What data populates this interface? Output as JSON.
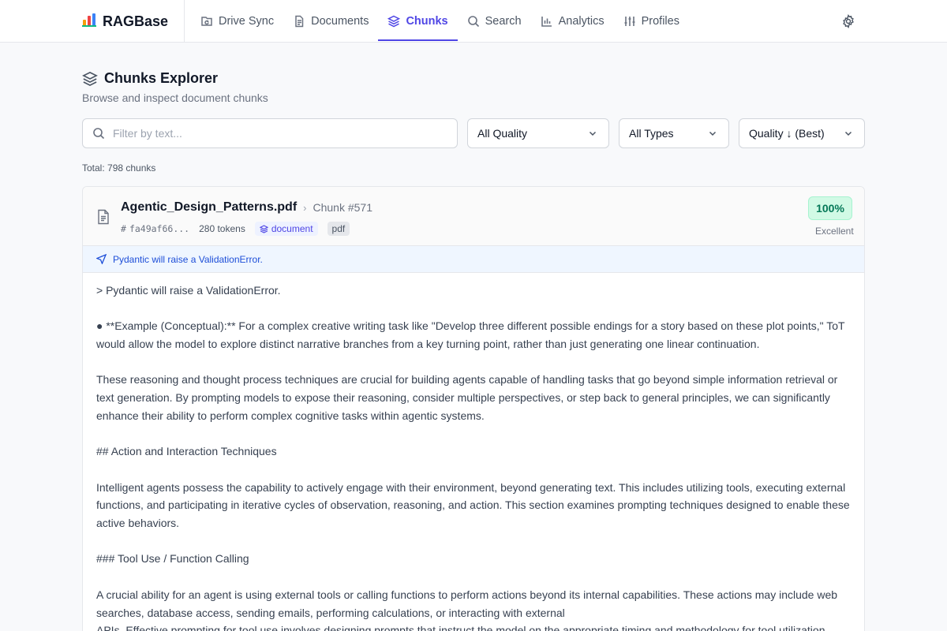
{
  "app": {
    "name": "RAGBase"
  },
  "nav": {
    "items": [
      {
        "label": "Drive Sync",
        "icon": "drive-sync-icon"
      },
      {
        "label": "Documents",
        "icon": "document-icon"
      },
      {
        "label": "Chunks",
        "icon": "layers-icon",
        "active": true
      },
      {
        "label": "Search",
        "icon": "search-icon"
      },
      {
        "label": "Analytics",
        "icon": "bar-chart-icon"
      },
      {
        "label": "Profiles",
        "icon": "sliders-icon"
      }
    ]
  },
  "page": {
    "title": "Chunks Explorer",
    "subtitle": "Browse and inspect document chunks"
  },
  "filters": {
    "search_placeholder": "Filter by text...",
    "quality": "All Quality",
    "type": "All Types",
    "sort": "Quality ↓ (Best)"
  },
  "total": "Total: 798 chunks",
  "chunk": {
    "file_name": "Agentic_Design_Patterns.pdf",
    "chunk_id": "Chunk #571",
    "hash": "fa49af66...",
    "tokens": "280 tokens",
    "type_badge": "document",
    "format_badge": "pdf",
    "score": "100%",
    "score_label": "Excellent",
    "summary": "Pydantic will raise a ValidationError.",
    "content": [
      "> Pydantic will raise a ValidationError.",
      "● **Example (Conceptual):** For a complex creative writing task like \"Develop three different possible endings for a story based on these plot points,\" ToT would allow the model to explore distinct narrative branches from a key turning point, rather than just generating one linear continuation.",
      "These reasoning and thought process techniques are crucial for building agents capable of handling tasks that go beyond simple information retrieval or text generation. By prompting models to expose their reasoning, consider multiple perspectives, or step back to general principles, we can significantly enhance their ability to perform complex cognitive tasks within agentic systems.",
      "## Action and Interaction Techniques",
      "Intelligent agents possess the capability to actively engage with their environment, beyond generating text. This includes utilizing tools, executing external functions, and participating in iterative cycles of observation, reasoning, and action. This section examines prompting techniques designed to enable these active behaviors.",
      "### Tool Use / Function Calling",
      "A crucial ability for an agent is using external tools or calling functions to perform actions beyond its internal capabilities. These actions may include web searches, database access, sending emails, performing calculations, or interacting with external\nAPIs. Effective prompting for tool use involves designing prompts that instruct the model on the appropriate timing and methodology for tool utilization."
    ]
  },
  "colors": {
    "accent": "#4f46e5",
    "score_bg": "#d1fae5",
    "score_text": "#047857",
    "summary_bg": "#eff6ff"
  }
}
